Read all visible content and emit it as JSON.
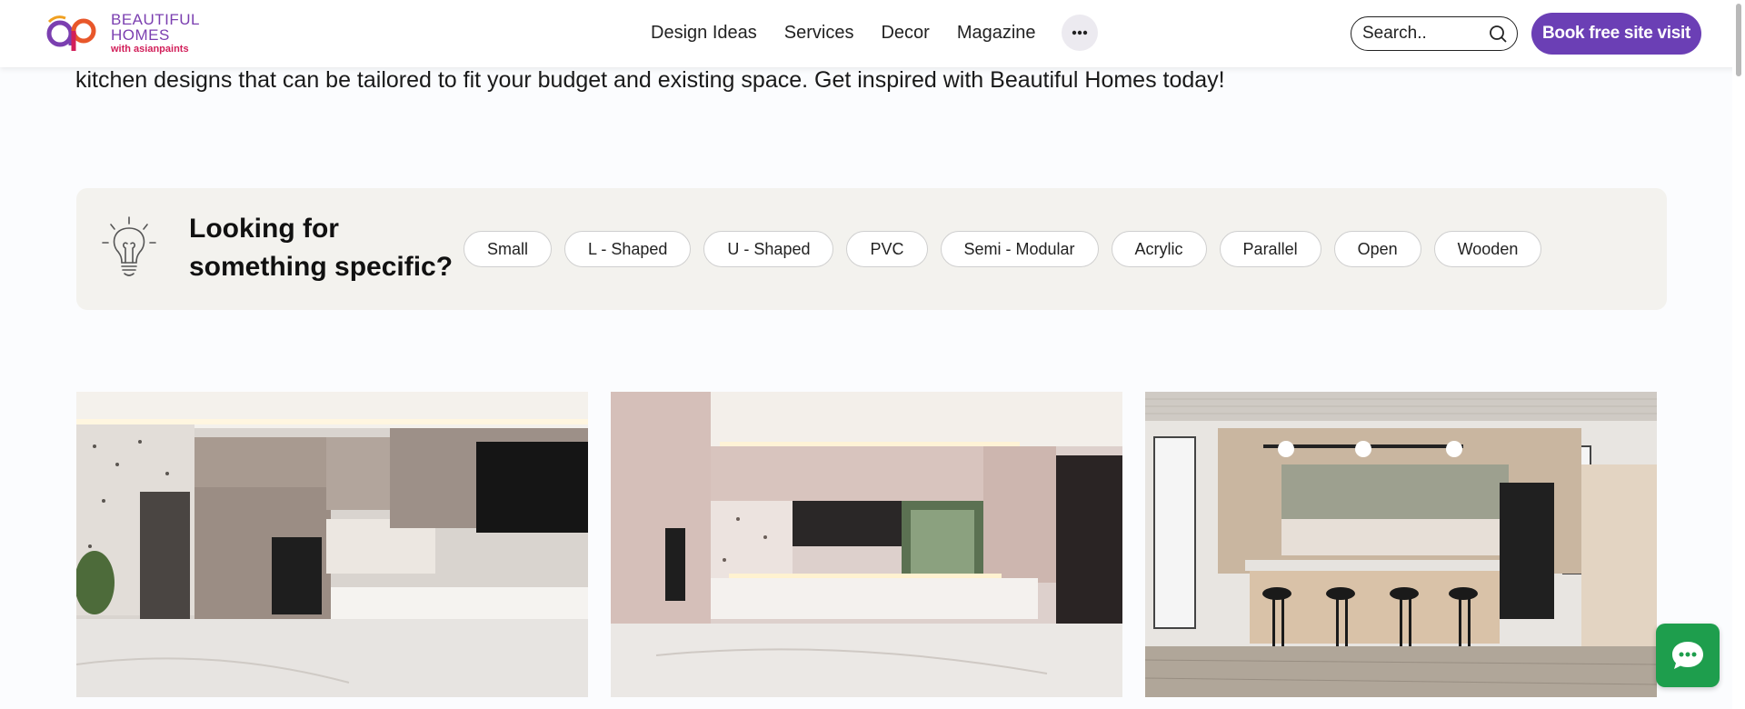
{
  "header": {
    "logo": {
      "line1": "BEAUTIFUL",
      "line2": "HOMES",
      "line3": "with asianpaints"
    },
    "nav": [
      {
        "label": "Design Ideas"
      },
      {
        "label": "Services"
      },
      {
        "label": "Decor"
      },
      {
        "label": "Magazine"
      }
    ],
    "more_icon": "ellipsis-icon",
    "search": {
      "placeholder": "Search..",
      "icon": "search-icon"
    },
    "cta_label": "Book free site visit"
  },
  "intro_text": "kitchen designs that can be tailored to fit your budget and existing space. Get inspired with Beautiful Homes today!",
  "filter": {
    "icon": "lightbulb-icon",
    "title_line1": "Looking for",
    "title_line2": "something specific?",
    "chips": [
      "Small",
      "L - Shaped",
      "U - Shaped",
      "PVC",
      "Semi - Modular",
      "Acrylic",
      "Parallel",
      "Open",
      "Wooden"
    ]
  },
  "cards": [
    {
      "icon": "kitchen-image"
    },
    {
      "icon": "kitchen-image"
    },
    {
      "icon": "kitchen-image"
    }
  ],
  "chat": {
    "icon": "chat-icon"
  },
  "colors": {
    "brand": "#6b3fb5",
    "panel": "#f3f2ee",
    "chat": "#1e9e4d"
  }
}
